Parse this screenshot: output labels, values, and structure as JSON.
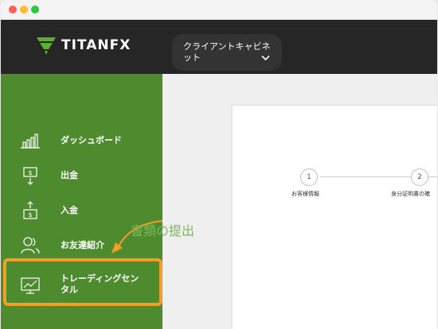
{
  "window": {
    "controls": [
      {
        "name": "close",
        "color": "#ff5f57"
      },
      {
        "name": "minimize",
        "color": "#febc2e"
      },
      {
        "name": "zoom",
        "color": "#28c840"
      }
    ]
  },
  "header": {
    "logo_text": "TITANFX",
    "logo_icon": "titanfx-logo-icon",
    "cabinet_label": "クライアントキャビネット",
    "cabinet_icon": "chevron-down-icon"
  },
  "sidebar": {
    "items": [
      {
        "label": "ダッシュボード",
        "icon": "bar-chart-icon"
      },
      {
        "label": "出金",
        "icon": "withdraw-icon"
      },
      {
        "label": "入金",
        "icon": "deposit-icon"
      },
      {
        "label": "お友達紹介",
        "icon": "users-icon"
      },
      {
        "label": "トレーディングセンタル",
        "icon": "monitor-chart-icon"
      }
    ],
    "active_index": 4
  },
  "main": {
    "steps": [
      {
        "number": "1",
        "label": "お客様情報"
      },
      {
        "number": "2",
        "label": "身分証明書の確"
      }
    ],
    "title": "書類の提出"
  },
  "colors": {
    "header_bg": "#262626",
    "sidebar_bg": "#4e8b2f",
    "accent_green": "#5db02e",
    "highlight_orange": "#f59d26",
    "title_green": "#7ab85a"
  }
}
